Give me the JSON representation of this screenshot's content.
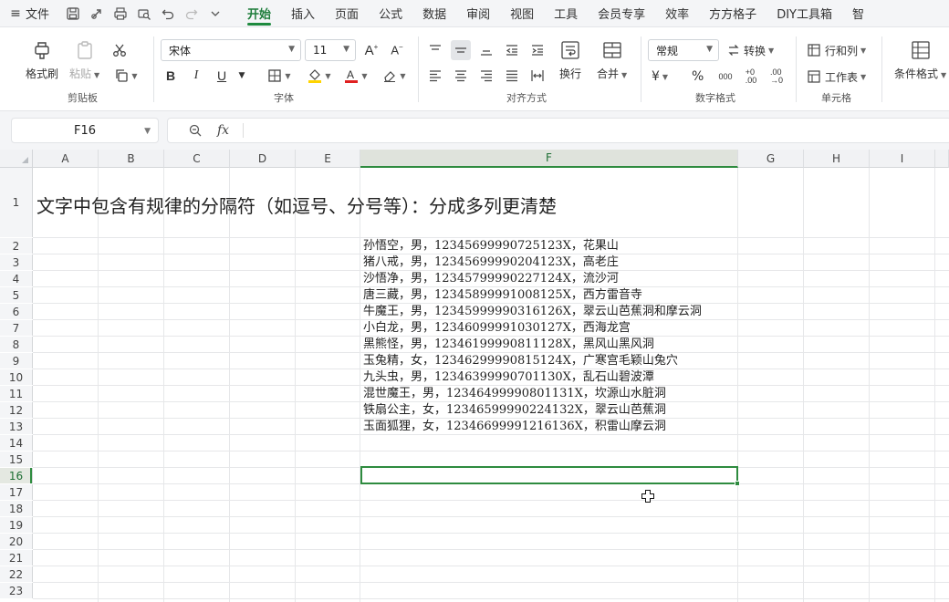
{
  "app": {
    "file_menu": "文件",
    "tabs": [
      "开始",
      "插入",
      "页面",
      "公式",
      "数据",
      "审阅",
      "视图",
      "工具",
      "会员专享",
      "效率",
      "方方格子",
      "DIY工具箱",
      "智"
    ]
  },
  "ribbon": {
    "clipboard": {
      "format_painter": "格式刷",
      "paste": "粘贴",
      "group_label": "剪贴板"
    },
    "font": {
      "font_name": "宋体",
      "font_size": "11",
      "bold": "B",
      "italic": "I",
      "underline": "U",
      "group_label": "字体"
    },
    "alignment": {
      "wrap": "换行",
      "merge": "合并",
      "group_label": "对齐方式"
    },
    "number": {
      "format": "常规",
      "convert": "转换",
      "currency": "¥",
      "percent": "%",
      "group_label": "数字格式"
    },
    "cells": {
      "row_col": "行和列",
      "worksheet": "工作表",
      "group_label": "单元格"
    },
    "styles": {
      "conditional": "条件格式"
    },
    "colors": {
      "accent": "#1e8a3e",
      "highlight": "#ffd400",
      "font_color": "#e02020"
    }
  },
  "formula_bar": {
    "name_box": "F16",
    "fx": "fx",
    "content": ""
  },
  "sheet": {
    "columns": [
      "A",
      "B",
      "C",
      "D",
      "E",
      "F",
      "G",
      "H",
      "I"
    ],
    "active_column": "F",
    "rows": [
      "1",
      "2",
      "3",
      "4",
      "5",
      "6",
      "7",
      "8",
      "9",
      "10",
      "11",
      "12",
      "13",
      "14",
      "15",
      "16",
      "17",
      "18",
      "19",
      "20",
      "21",
      "22",
      "23"
    ],
    "active_row": "16",
    "title": "文字中包含有规律的分隔符（如逗号、分号等）：分成多列更清楚",
    "data": [
      "孙悟空，男，12345699990725123X，花果山",
      "猪八戒，男，12345699990204123X，高老庄",
      "沙悟净，男，12345799990227124X，流沙河",
      "唐三藏，男，12345899991008125X，西方雷音寺",
      "牛魔王，男，12345999990316126X，翠云山芭蕉洞和摩云洞",
      "小白龙，男，12346099991030127X，西海龙宫",
      "黑熊怪，男，12346199990811128X，黑风山黑风洞",
      "玉兔精，女，12346299990815124X，广寒宫毛颖山兔穴",
      "九头虫，男，12346399990701130X，乱石山碧波潭",
      "混世魔王，男，12346499990801131X，坎源山水脏洞",
      "铁扇公主，女，12346599990224132X，翠云山芭蕉洞",
      "玉面狐狸，女，12346699991216136X，积雷山摩云洞"
    ]
  }
}
